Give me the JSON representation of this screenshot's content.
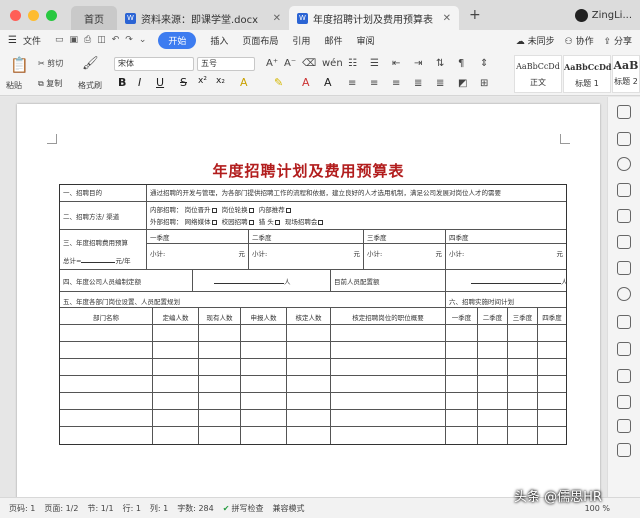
{
  "window": {
    "tabs": [
      {
        "label": "首页"
      },
      {
        "label": "资料来源：即课学堂.docx"
      },
      {
        "label": "年度招聘计划及费用预算表"
      }
    ],
    "user_name": "ZingLi..."
  },
  "menu": {
    "file": "文件",
    "items": [
      "开始",
      "插入",
      "页面布局",
      "引用",
      "邮件",
      "审阅"
    ],
    "active": "开始",
    "sync": "未同步",
    "collab": "协作",
    "share": "分享"
  },
  "ribbon": {
    "cut": "剪切",
    "copy": "复制",
    "paste": "粘贴",
    "format_painter": "格式刷",
    "font_name": "宋体",
    "font_size": "五号",
    "styles": [
      {
        "sample": "AaBbCcDd",
        "name": "正文"
      },
      {
        "sample": "AaBbCcDd",
        "name": "标题 1"
      },
      {
        "sample": "AaB",
        "name": "标题 2"
      }
    ]
  },
  "document": {
    "title": "年度招聘计划及费用预算表",
    "row1": {
      "label": "一、招聘目的",
      "text": "通过招聘的开发与管理，为各部门提供招聘工作的流程和依据，建立良好的人才选用机制，满足公司发展对岗位人才的需要"
    },
    "row2": {
      "label": "二、招聘方法/ 渠道",
      "internal_label": "内部招聘：",
      "internal_opts": [
        "岗位晋升",
        "岗位轮换",
        "内部推荐"
      ],
      "external_label": "外部招聘：",
      "external_opts": [
        "网络媒体",
        "校园招聘",
        "猎  头",
        "现场招聘会"
      ]
    },
    "row3": {
      "label": "三、年度招聘费用预算",
      "quarters": [
        "一季度",
        "二季度",
        "三季度",
        "四季度"
      ],
      "subtotal": "小计:",
      "yuan": "元",
      "total_label": "总计=",
      "total_unit": "元/年"
    },
    "row4": {
      "label": "四、年度公司人员编制定额",
      "unit": "人",
      "target_label": "目前人员配置额"
    },
    "row5": {
      "label": "五、年度各部门岗位设置、人员配置规划",
      "right_label": "六、招聘实施时间计划"
    },
    "headers": [
      "部门名称",
      "定编人数",
      "现有人数",
      "申报人数",
      "核定人数",
      "核定招聘岗位的职位概要",
      "一季度",
      "二季度",
      "三季度",
      "四季度"
    ],
    "empty_rows": 7
  },
  "status": {
    "page": "页码: 1",
    "pages": "页面: 1/2",
    "section": "节: 1/1",
    "row": "行: 1",
    "col": "列: 1",
    "words": "字数: 284",
    "spell": "拼写检查",
    "compat": "兼容模式",
    "zoom": "100 %"
  },
  "watermark": "头条 @儒思HR"
}
